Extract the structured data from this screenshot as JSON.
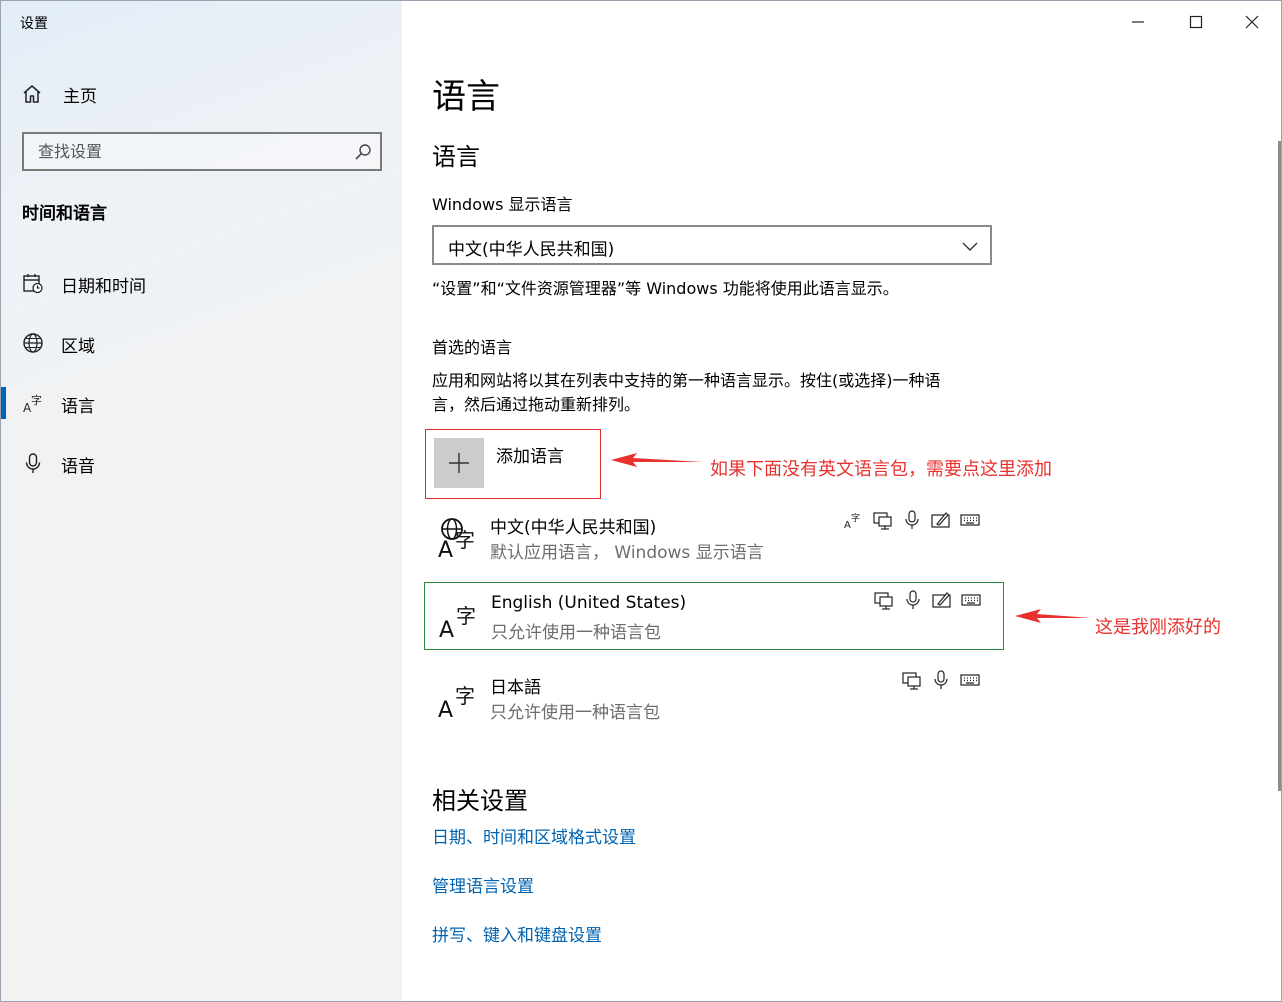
{
  "window": {
    "title": "设置",
    "controls": [
      "minimize",
      "maximize",
      "close"
    ]
  },
  "sidebar": {
    "home_label": "主页",
    "search_placeholder": "查找设置",
    "section_title": "时间和语言",
    "items": [
      {
        "icon": "calendar-clock-icon",
        "label": "日期和时间",
        "active": false
      },
      {
        "icon": "globe-icon",
        "label": "区域",
        "active": false
      },
      {
        "icon": "language-icon",
        "label": "语言",
        "active": true
      },
      {
        "icon": "microphone-icon",
        "label": "语音",
        "active": false
      }
    ]
  },
  "main": {
    "page_title": "语言",
    "section_language": "语言",
    "display_language_label": "Windows 显示语言",
    "display_language_value": "中文(中华人民共和国)",
    "display_language_note": "“设置”和“文件资源管理器”等 Windows 功能将使用此语言显示。",
    "preferred_title": "首选的语言",
    "preferred_desc_line1": "应用和网站将以其在列表中支持的第一种语言显示。按住(或选择)一种语",
    "preferred_desc_line2": "言，然后通过拖动重新排列。",
    "add_language_label": "添加语言",
    "languages": [
      {
        "name": "中文(中华人民共和国)",
        "sub": "默认应用语言， Windows 显示语言",
        "features": [
          "display-language-icon",
          "text-to-speech-icon",
          "speech-icon",
          "handwriting-icon",
          "keyboard-icon"
        ],
        "selected": false
      },
      {
        "name": "English (United States)",
        "sub": "只允许使用一种语言包",
        "features": [
          "text-to-speech-icon",
          "speech-icon",
          "handwriting-icon",
          "keyboard-icon"
        ],
        "selected": true
      },
      {
        "name": "日本語",
        "sub": "只允许使用一种语言包",
        "features": [
          "text-to-speech-icon",
          "speech-icon",
          "keyboard-icon"
        ],
        "selected": false
      }
    ],
    "related_title": "相关设置",
    "related_links": [
      "日期、时间和区域格式设置",
      "管理语言设置",
      "拼写、键入和键盘设置"
    ]
  },
  "annotations": {
    "add_hint": "如果下面没有英文语言包，需要点这里添加",
    "added_hint": "这是我刚添好的",
    "color": "#e8322f"
  },
  "colors": {
    "accent": "#0063b1",
    "highlight_red": "#e53030",
    "highlight_green": "#2b8a3e"
  }
}
